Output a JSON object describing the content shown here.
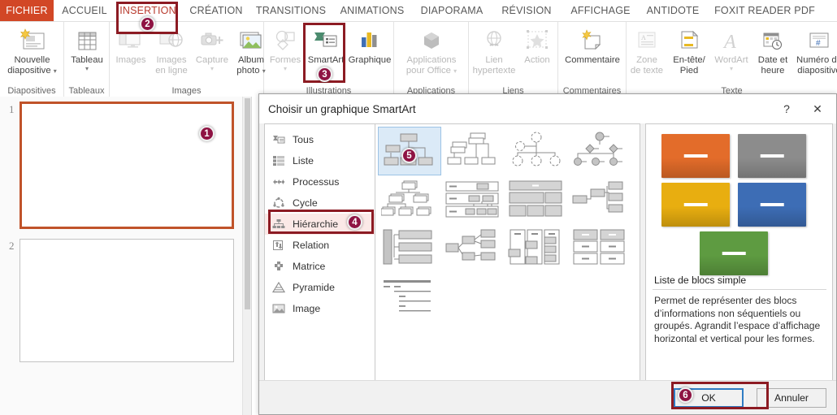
{
  "ribbon": {
    "tabs": [
      {
        "label": "FICHIER",
        "type": "file"
      },
      {
        "label": "ACCUEIL",
        "type": "normal"
      },
      {
        "label": "INSERTION",
        "type": "active"
      },
      {
        "label": "CRÉATION",
        "type": "normal"
      },
      {
        "label": "TRANSITIONS",
        "type": "normal"
      },
      {
        "label": "ANIMATIONS",
        "type": "normal"
      },
      {
        "label": "DIAPORAMA",
        "type": "normal"
      },
      {
        "label": "RÉVISION",
        "type": "normal"
      },
      {
        "label": "AFFICHAGE",
        "type": "normal"
      },
      {
        "label": "ANTIDOTE",
        "type": "normal"
      },
      {
        "label": "FOXIT READER PDF",
        "type": "normal"
      }
    ],
    "groups": [
      {
        "label": "Diapositives"
      },
      {
        "label": "Tableaux"
      },
      {
        "label": "Images"
      },
      {
        "label": "Illustrations"
      },
      {
        "label": "Applications"
      },
      {
        "label": "Liens"
      },
      {
        "label": "Commentaires"
      },
      {
        "label": "Texte"
      }
    ],
    "buttons": {
      "new_slide": "Nouvelle\ndiapositive",
      "new_slide_l1": "Nouvelle",
      "new_slide_l2": "diapositive",
      "table": "Tableau",
      "images": "Images",
      "online_images_l1": "Images",
      "online_images_l2": "en ligne",
      "capture": "Capture",
      "photo_album_l1": "Album",
      "photo_album_l2": "photo",
      "shapes": "Formes",
      "smartart": "SmartArt",
      "chart": "Graphique",
      "office_apps_l1": "Applications",
      "office_apps_l2": "pour Office",
      "hyperlink_l1": "Lien",
      "hyperlink_l2": "hypertexte",
      "action": "Action",
      "comment": "Commentaire",
      "textbox_l1": "Zone",
      "textbox_l2": "de texte",
      "headerfooter_l1": "En-tête/",
      "headerfooter_l2": "Pied",
      "wordart": "WordArt",
      "datetime_l1": "Date et",
      "datetime_l2": "heure",
      "slidenumber_l1": "Numéro de",
      "slidenumber_l2": "diapositive"
    }
  },
  "slides": {
    "items": [
      {
        "number": "1",
        "selected": true
      },
      {
        "number": "2",
        "selected": false
      }
    ]
  },
  "dialog": {
    "title": "Choisir un graphique SmartArt",
    "help_icon": "?",
    "close_icon": "✕",
    "categories": [
      {
        "label": "Tous",
        "icon": "all-icon",
        "selected": false
      },
      {
        "label": "Liste",
        "icon": "list-icon",
        "selected": false
      },
      {
        "label": "Processus",
        "icon": "process-icon",
        "selected": false
      },
      {
        "label": "Cycle",
        "icon": "cycle-icon",
        "selected": false
      },
      {
        "label": "Hiérarchie",
        "icon": "hierarchy-icon",
        "selected": true
      },
      {
        "label": "Relation",
        "icon": "relationship-icon",
        "selected": false
      },
      {
        "label": "Matrice",
        "icon": "matrix-icon",
        "selected": false
      },
      {
        "label": "Pyramide",
        "icon": "pyramid-icon",
        "selected": false
      },
      {
        "label": "Image",
        "icon": "picture-icon",
        "selected": false
      }
    ],
    "preview": {
      "name": "Liste de blocs simple",
      "description": "Permet de représenter des blocs d’informations non séquentiels ou groupés. Agrandit l’espace d’affichage horizontal et vertical pour les formes.",
      "block_colors": [
        "#E36C2A",
        "#8C8C8C",
        "#E8AE10",
        "#3D6DB5",
        "#5E9B41"
      ]
    },
    "footer": {
      "ok_label": "OK",
      "cancel_label": "Annuler"
    }
  },
  "annotations": {
    "badges": [
      {
        "number": "1",
        "target": "slide-1-thumbnail"
      },
      {
        "number": "2",
        "target": "insertion-tab"
      },
      {
        "number": "3",
        "target": "smartart-button"
      },
      {
        "number": "4",
        "target": "hierarchy-category"
      },
      {
        "number": "5",
        "target": "first-smartart-thumbnail"
      },
      {
        "number": "6",
        "target": "ok-button"
      }
    ],
    "box_color": "#8C1B23",
    "badge_color": "#8E1343"
  }
}
